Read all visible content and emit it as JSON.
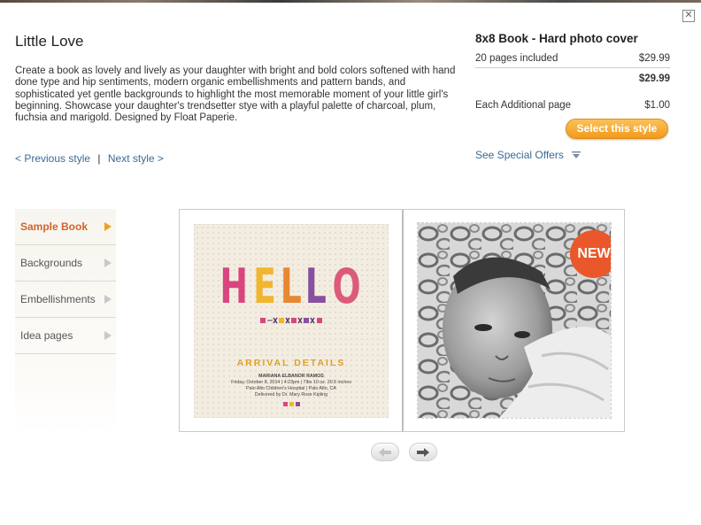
{
  "product": {
    "title": "Little Love",
    "description": "Create a book as lovely and lively as your daughter with bright and bold colors softened with hand done type and hip sentiments, modern organic embellishments and pattern bands, and sophisticated yet gentle backgrounds to highlight the most memorable moment of your little girl's beginning. Showcase your daughter's trendsetter stye with a playful palette of charcoal, plum, fuchsia and marigold. Designed by Float Paperie.",
    "prev_label": "< Previous style",
    "separator": "|",
    "next_label": "Next style >"
  },
  "pricing": {
    "title": "8x8 Book - Hard photo cover",
    "pages_label": "20 pages included",
    "pages_price": "$29.99",
    "total": "$29.99",
    "additional_label": "Each Additional page",
    "additional_price": "$1.00",
    "select_label": "Select this style",
    "offers_label": "See Special Offers"
  },
  "sidebar": {
    "items": [
      {
        "label": "Sample Book"
      },
      {
        "label": "Backgrounds"
      },
      {
        "label": "Embellishments"
      },
      {
        "label": "Idea pages"
      }
    ]
  },
  "book": {
    "hello_letters": [
      "H",
      "E",
      "L",
      "L",
      "O"
    ],
    "hello_colors": [
      "#d9467f",
      "#f2b52e",
      "#e8872f",
      "#8a4f9e",
      "#dc5a7a"
    ],
    "arrival_title": "ARRIVAL DETAILS",
    "detail_name": "MARIANA ELBANOR RAMOS",
    "detail_line2": "Friday, October 8, 2014  |  4:23pm  |  7lbs 10 oz. 20.5 inches",
    "detail_line3": "Palo Alto Children's Hospital  |  Palo Alto, CA",
    "detail_line4": "Delivered by Dr. Mary Rose Kipling",
    "new_badge": "NEW"
  },
  "colors": {
    "accent_orange": "#f29a1a",
    "link_blue": "#3b6a96",
    "active_tab": "#d0652a"
  }
}
